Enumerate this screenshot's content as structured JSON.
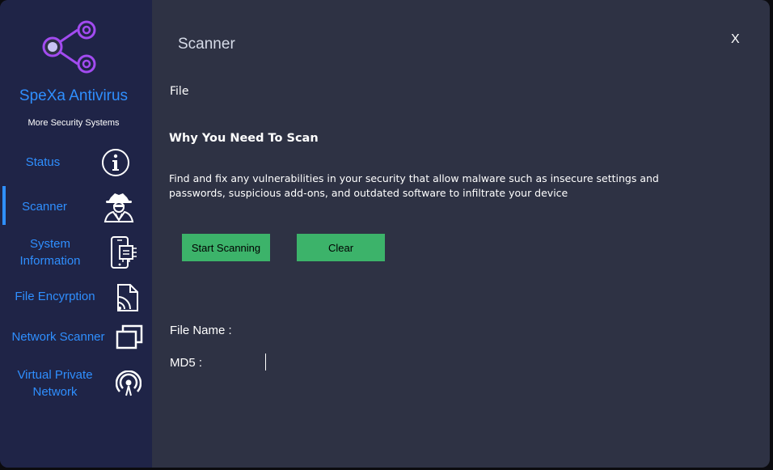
{
  "app": {
    "name": "SpeXa Antivirus",
    "tagline": "More Security Systems",
    "accent_color": "#2f8fff",
    "logo_color": "#a24bf0"
  },
  "sidebar": {
    "items": [
      {
        "label": "Status",
        "icon": "info-icon"
      },
      {
        "label": "Scanner",
        "icon": "spy-icon",
        "active": true
      },
      {
        "label": "System\nInformation",
        "icon": "device-chip-icon"
      },
      {
        "label": "File Encyrption",
        "icon": "file-signal-icon"
      },
      {
        "label": "Network Scanner",
        "icon": "windows-stack-icon"
      },
      {
        "label": "Virtual Private\nNetwork",
        "icon": "broadcast-icon"
      }
    ]
  },
  "main": {
    "title": "Scanner",
    "close_label": "X",
    "file_label": "File",
    "heading": "Why You Need To Scan",
    "description": "Find and fix any vulnerabilities in your security that allow malware such as insecure settings and passwords, suspicious add-ons, and outdated software to infiltrate your device",
    "start_button": "Start Scanning",
    "clear_button": "Clear",
    "button_color": "#3cb36a",
    "file_name_label": "File Name :",
    "md5_label": "MD5 :"
  }
}
